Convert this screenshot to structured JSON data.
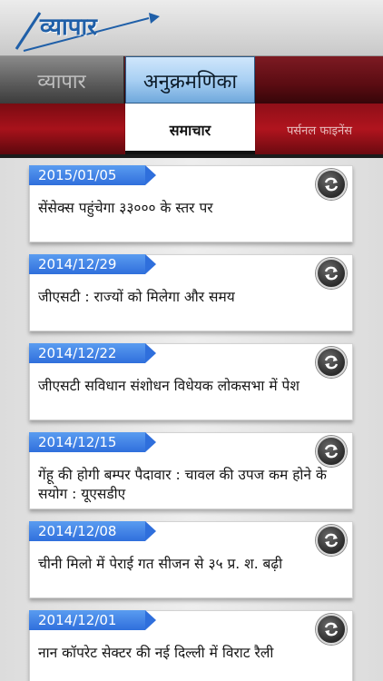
{
  "app": {
    "logo_text": "व्यापार",
    "colors": {
      "accent_blue": "#2f6fdc",
      "brand_red": "#9a1018",
      "logo_blue": "#1f5fa8"
    }
  },
  "tabs": {
    "left": "व्यापार",
    "active": "अनुक्रमणिका"
  },
  "subtabs": {
    "active": "समाचार",
    "right": "पर्सनल फाइनेंस"
  },
  "news": [
    {
      "date": "2015/01/05",
      "headline": "सेंसेक्स पहुंचेगा ३३००० के स्तर पर",
      "icon": "refresh-icon"
    },
    {
      "date": "2014/12/29",
      "headline": "जीएसटी : राज्यों को मिलेगा और समय",
      "icon": "refresh-icon"
    },
    {
      "date": "2014/12/22",
      "headline": "जीएसटी सविधान संशोधन विधेयक लोकसभा में पेश",
      "icon": "refresh-icon"
    },
    {
      "date": "2014/12/15",
      "headline": "गेंहू की होगी बम्पर पैदावार : चावल की उपज कम होने के सयोग : यूएसडीए",
      "icon": "refresh-icon"
    },
    {
      "date": "2014/12/08",
      "headline": "चीनी मिलो में पेराई गत सीजन से ३५ प्र. श. बढ़ी",
      "icon": "refresh-icon"
    },
    {
      "date": "2014/12/01",
      "headline": "नान कॉपरेट सेक्टर की नई दिल्ली में विराट रैली",
      "icon": "refresh-icon"
    }
  ]
}
